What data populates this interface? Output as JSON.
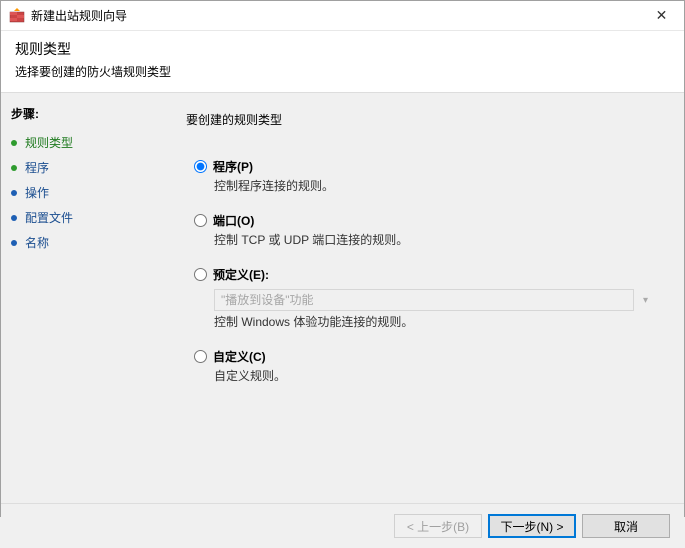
{
  "window": {
    "title": "新建出站规则向导",
    "close": "✕"
  },
  "header": {
    "title": "规则类型",
    "subtitle": "选择要创建的防火墙规则类型"
  },
  "sidebar": {
    "steps_label": "步骤:",
    "items": [
      {
        "label": "规则类型",
        "current": true
      },
      {
        "label": "程序"
      },
      {
        "label": "操作"
      },
      {
        "label": "配置文件"
      },
      {
        "label": "名称"
      }
    ]
  },
  "main": {
    "question": "要创建的规则类型",
    "options": [
      {
        "key": "program",
        "label": "程序(P)",
        "desc": "控制程序连接的规则。",
        "checked": true
      },
      {
        "key": "port",
        "label": "端口(O)",
        "desc": "控制 TCP 或 UDP 端口连接的规则。",
        "checked": false
      },
      {
        "key": "predefined",
        "label": "预定义(E):",
        "desc": "控制 Windows 体验功能连接的规则。",
        "checked": false,
        "combo_value": "\"播放到设备\"功能"
      },
      {
        "key": "custom",
        "label": "自定义(C)",
        "desc": "自定义规则。",
        "checked": false
      }
    ]
  },
  "footer": {
    "back": "< 上一步(B)",
    "next": "下一步(N) >",
    "cancel": "取消"
  }
}
